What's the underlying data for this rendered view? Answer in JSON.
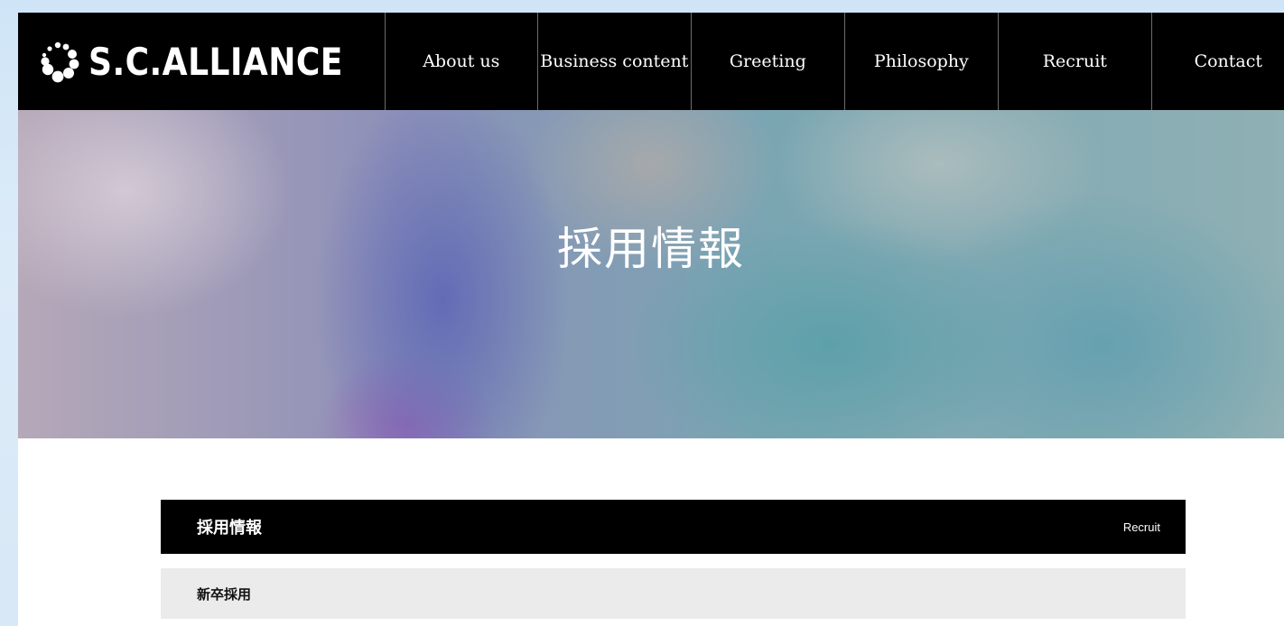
{
  "header": {
    "logo_text": "S.C.ALLIANCE",
    "logo_icon": "bubble-cluster-icon",
    "nav": [
      {
        "label": "About us"
      },
      {
        "label": "Business content"
      },
      {
        "label": "Greeting"
      },
      {
        "label": "Philosophy"
      },
      {
        "label": "Recruit"
      },
      {
        "label": "Contact"
      }
    ]
  },
  "hero": {
    "title": "採用情報"
  },
  "section": {
    "title": "採用情報",
    "subtitle": "Recruit",
    "items": [
      {
        "label": "新卒採用"
      }
    ]
  },
  "colors": {
    "header_bg": "#000000",
    "section_head_bg": "#000000",
    "sub_row_bg": "#ebebeb",
    "outer_bg": "#d4e7f7"
  }
}
